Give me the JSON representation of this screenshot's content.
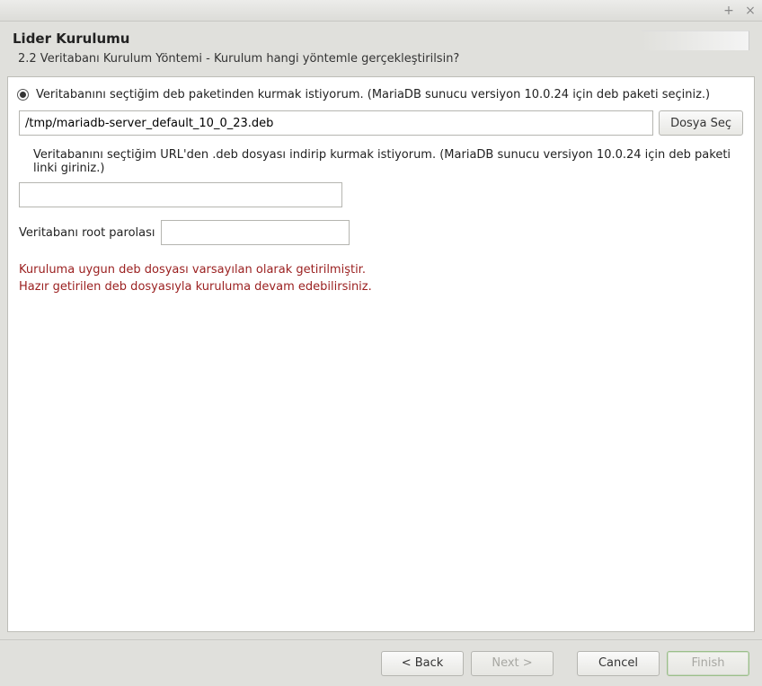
{
  "titlebar": {
    "maximize_icon": "+",
    "close_icon": "×"
  },
  "header": {
    "title": "Lider Kurulumu",
    "subtitle": "2.2 Veritabanı Kurulum Yöntemi - Kurulum hangi yöntemle gerçekleştirilsin?"
  },
  "option_deb": {
    "label": "Veritabanını seçtiğim deb paketinden kurmak istiyorum. (MariaDB sunucu versiyon 10.0.24  için deb paketi seçiniz.)",
    "path_value": "/tmp/mariadb-server_default_10_0_23.deb",
    "choose_button": "Dosya Seç"
  },
  "option_url": {
    "label": "Veritabanını seçtiğim URL'den .deb dosyası indirip kurmak istiyorum. (MariaDB sunucu versiyon 10.0.24 için deb paketi linki giriniz.)",
    "url_value": ""
  },
  "password": {
    "label": "Veritabanı root parolası",
    "value": ""
  },
  "info": {
    "line1": "Kuruluma uygun deb dosyası varsayılan olarak getirilmiştir.",
    "line2": "Hazır getirilen deb dosyasıyla kuruluma devam edebilirsiniz."
  },
  "footer": {
    "back": "< Back",
    "next": "Next >",
    "cancel": "Cancel",
    "finish": "Finish"
  }
}
